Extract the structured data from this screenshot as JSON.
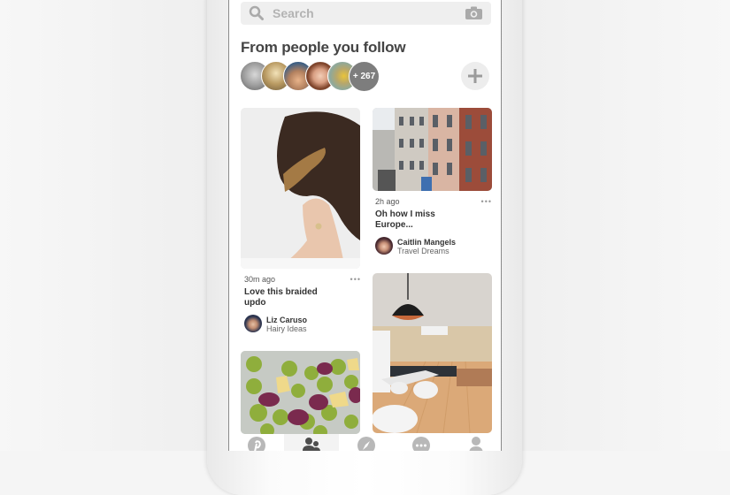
{
  "search": {
    "placeholder": "Search",
    "icon": "search-icon",
    "camera_icon": "camera-icon"
  },
  "following": {
    "title": "From people you follow",
    "avatars": [
      {
        "label": "followed-user-1"
      },
      {
        "label": "followed-user-2"
      },
      {
        "label": "followed-user-3"
      },
      {
        "label": "followed-user-4"
      },
      {
        "label": "followed-user-5"
      }
    ],
    "more_count": "+ 267",
    "add_icon": "plus-icon"
  },
  "pins": [
    {
      "time": "30m ago",
      "description": "Love this braided updo",
      "user": "Liz Caruso",
      "board": "Hairy Ideas",
      "image": "braided hair updo"
    },
    {
      "time": "2h ago",
      "description": "Oh how I miss Europe...",
      "user": "Caitlin Mangels",
      "board": "Travel Dreams",
      "image": "european street buildings"
    },
    {
      "image": "dining room interior"
    },
    {
      "image": "brussels sprouts skewers"
    }
  ],
  "more_icon": "more-dots-icon",
  "tabbar": {
    "tabs": [
      {
        "name": "home",
        "icon": "pinterest-icon",
        "active": false
      },
      {
        "name": "following",
        "icon": "people-icon",
        "active": true
      },
      {
        "name": "explore",
        "icon": "compass-icon",
        "active": false
      },
      {
        "name": "messages",
        "icon": "chat-bubble-icon",
        "active": false
      },
      {
        "name": "profile",
        "icon": "person-icon",
        "active": false
      }
    ]
  },
  "colors": {
    "accent_gray": "#7d7d7d",
    "search_bg": "#efefef",
    "text_dark": "#333333"
  }
}
